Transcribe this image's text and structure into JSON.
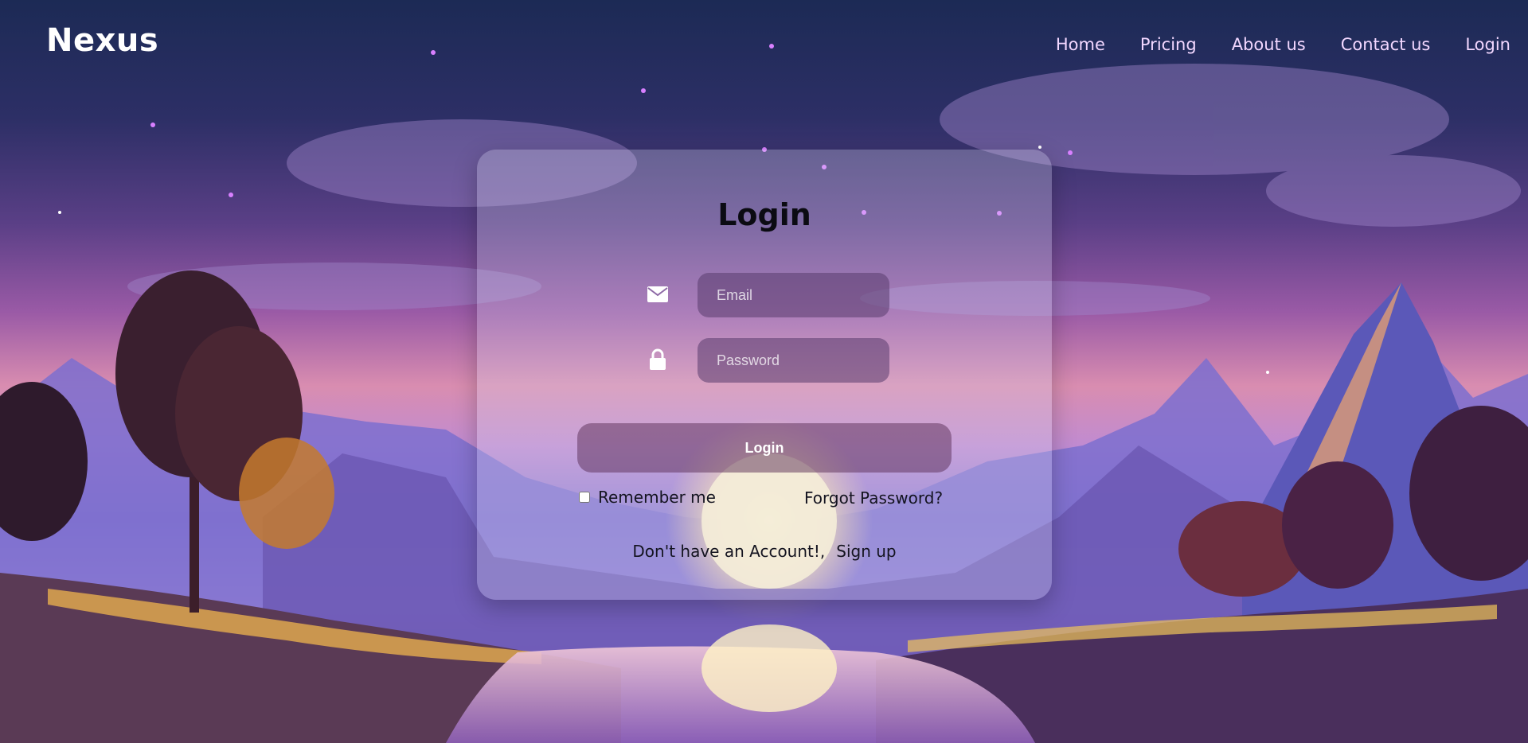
{
  "header": {
    "logo": "Nexus",
    "nav": [
      "Home",
      "Pricing",
      "About us",
      "Contact us",
      "Login"
    ]
  },
  "login_form": {
    "title": "Login",
    "email_placeholder": "Email",
    "password_placeholder": "Password",
    "submit_label": "Login",
    "remember_label": "Remember me",
    "remember_checked": false,
    "forgot_label": "Forgot Password?",
    "signup_prompt": "Don't have an Account!,",
    "signup_link": "Sign up"
  },
  "icons": {
    "email": "envelope-icon",
    "password": "lock-icon"
  },
  "colors": {
    "logo": "#ffffff",
    "nav_link": "#f2d7ff",
    "card_bg": "rgba(220,220,240,0.28)",
    "input_bg": "rgba(90,60,110,0.55)",
    "button_bg": "rgba(90,45,85,0.50)"
  }
}
